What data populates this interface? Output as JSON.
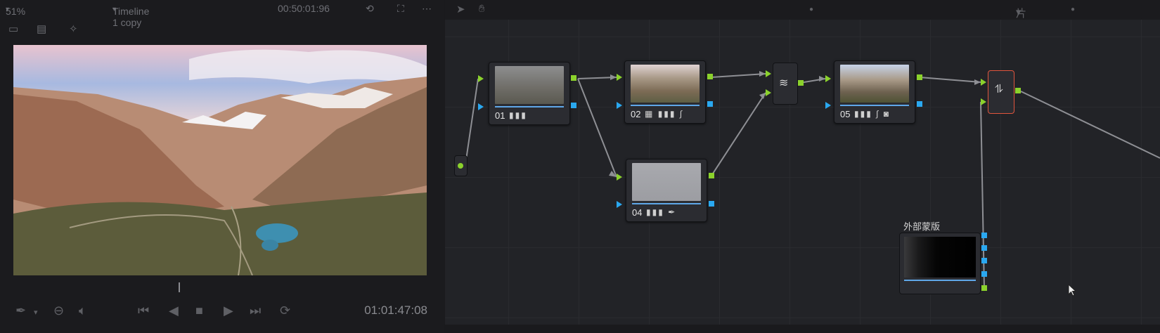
{
  "viewer": {
    "zoom": "51%",
    "timeline_name": "Timeline 1 copy",
    "source_timecode": "00:50:01:96",
    "record_timecode": "01:01:47:08",
    "scrub_position_fraction": 0.4
  },
  "node_editor": {
    "mode_label": "片段",
    "nodes": [
      {
        "id": "01",
        "tools": "bars"
      },
      {
        "id": "02",
        "tools": "grid bars curve"
      },
      {
        "id": "04",
        "tools": "bars picker"
      },
      {
        "id": "05",
        "tools": "bars curve window"
      }
    ],
    "external_matte_label": "外部蒙版"
  },
  "icons": {
    "pointer": "pointer-icon",
    "hand": "hand-icon",
    "layer_mixer": "layer-mixer-icon",
    "output_merge": "merge-icon"
  },
  "colors": {
    "rgb_pin": "#8bd22c",
    "key_pin": "#2aa8f0",
    "selected_node_border": "#e0553d"
  }
}
